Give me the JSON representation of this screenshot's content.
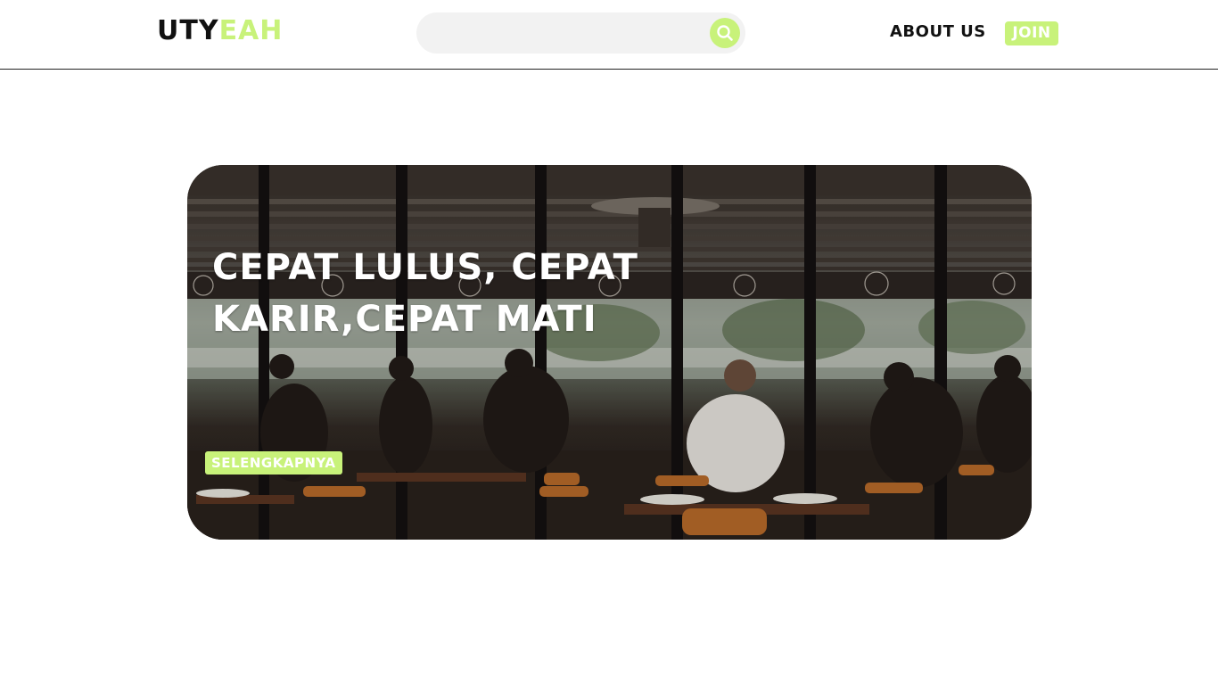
{
  "header": {
    "logo_part_a": "UTY",
    "logo_part_b": "EAH",
    "search": {
      "placeholder": ""
    },
    "nav_about": "ABOUT US",
    "nav_join": "JOIN"
  },
  "hero": {
    "title": "CEPAT LULUS, CEPAT KARIR,CEPAT MATI",
    "button_label": "SELENGKAPNYA"
  },
  "colors": {
    "accent": "#c8f27a",
    "text_dark": "#111111",
    "header_border": "#222222"
  },
  "icons": {
    "search": "search-icon"
  }
}
